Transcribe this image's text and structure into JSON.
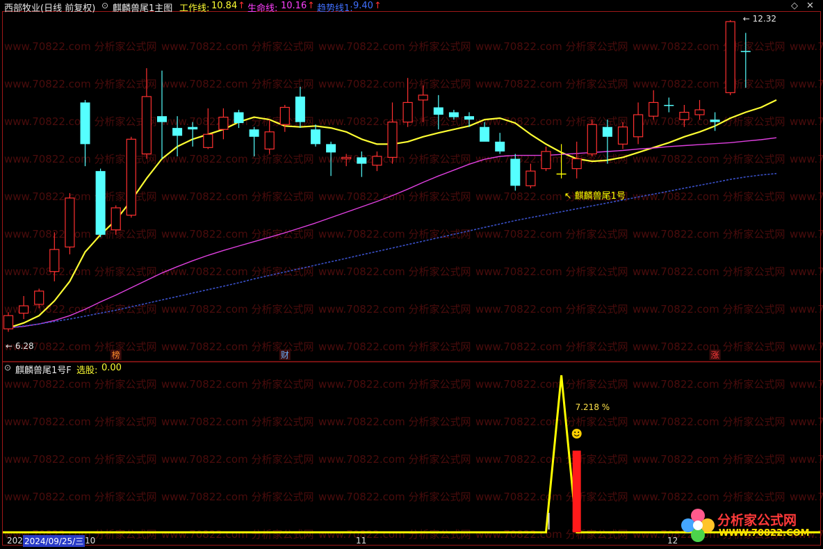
{
  "header": {
    "stock_title": "西部牧业(日线 前复权)",
    "main_indicator": "麒麟兽尾1主图",
    "work_line_label": "工作线:",
    "work_line_value": "10.84",
    "life_line_label": "生命线:",
    "life_line_value": "10.16",
    "trend_line_label": "趋势线1:",
    "trend_line_value": "9.40",
    "up_arrow": "↑",
    "sub_indicator": "麒麟兽尾1号F",
    "select_label": "选股:",
    "select_value": "0.00"
  },
  "colors": {
    "up": "#ff3030",
    "down": "#55ffff",
    "signal": "#ffff00",
    "work_line": "#ffff33",
    "life_line": "#e040e0",
    "trend_line": "#3a50c8",
    "frame": "#a01818",
    "watermark": "#4a0c0c"
  },
  "icons": {
    "settings": "diamond-icon",
    "close": "close-icon",
    "smiley": "smiley-icon"
  },
  "watermark_text": "www.70822.com 分析家公式网",
  "logo": {
    "cn": "分析家公式网",
    "url": "WWW.70822.COM"
  },
  "chart_data": [
    {
      "type": "candlestick",
      "title": "麒麟兽尾1主图",
      "ylim": [
        5.9,
        12.75
      ],
      "price_high_label": "12.32",
      "price_low_label": "6.28",
      "signal_label": "麒麟兽尾1号",
      "signal_index": 36,
      "event_markers": [
        {
          "index": 7,
          "text": "榜",
          "color": "#ff8c2c"
        },
        {
          "index": 18,
          "text": "财",
          "color": "#6ab0ff"
        },
        {
          "index": 46,
          "text": "涨",
          "color": "#ff3b3b"
        }
      ],
      "candles": [
        {
          "o": 6.28,
          "c": 6.55,
          "h": 6.62,
          "l": 6.22
        },
        {
          "o": 6.6,
          "c": 6.75,
          "h": 6.95,
          "l": 6.48
        },
        {
          "o": 6.78,
          "c": 7.05,
          "h": 7.1,
          "l": 6.7
        },
        {
          "o": 7.45,
          "c": 7.9,
          "h": 8.25,
          "l": 7.25
        },
        {
          "o": 7.95,
          "c": 8.95,
          "h": 9.05,
          "l": 7.8
        },
        {
          "o": 10.9,
          "c": 10.05,
          "h": 10.95,
          "l": 9.6
        },
        {
          "o": 9.5,
          "c": 8.2,
          "h": 9.55,
          "l": 8.15
        },
        {
          "o": 8.3,
          "c": 8.75,
          "h": 8.8,
          "l": 8.2
        },
        {
          "o": 8.6,
          "c": 10.15,
          "h": 10.2,
          "l": 8.55
        },
        {
          "o": 9.85,
          "c": 11.02,
          "h": 11.6,
          "l": 9.75
        },
        {
          "o": 10.62,
          "c": 10.5,
          "h": 11.55,
          "l": 9.75
        },
        {
          "o": 10.38,
          "c": 10.22,
          "h": 10.62,
          "l": 9.8
        },
        {
          "o": 10.4,
          "c": 10.35,
          "h": 10.5,
          "l": 10.0
        },
        {
          "o": 9.98,
          "c": 10.25,
          "h": 10.78,
          "l": 9.95
        },
        {
          "o": 10.35,
          "c": 10.6,
          "h": 10.78,
          "l": 10.15
        },
        {
          "o": 10.7,
          "c": 10.48,
          "h": 10.75,
          "l": 10.38
        },
        {
          "o": 10.35,
          "c": 10.2,
          "h": 10.4,
          "l": 9.8
        },
        {
          "o": 9.95,
          "c": 10.3,
          "h": 10.55,
          "l": 9.85
        },
        {
          "o": 10.45,
          "c": 10.8,
          "h": 10.85,
          "l": 10.3
        },
        {
          "o": 11.02,
          "c": 10.5,
          "h": 11.22,
          "l": 10.38
        },
        {
          "o": 10.35,
          "c": 10.05,
          "h": 10.45,
          "l": 10.0
        },
        {
          "o": 10.05,
          "c": 9.88,
          "h": 10.1,
          "l": 9.4
        },
        {
          "o": 9.75,
          "c": 9.78,
          "h": 9.85,
          "l": 9.6
        },
        {
          "o": 9.78,
          "c": 9.65,
          "h": 9.9,
          "l": 9.38
        },
        {
          "o": 9.62,
          "c": 9.8,
          "h": 9.9,
          "l": 9.5
        },
        {
          "o": 9.78,
          "c": 10.5,
          "h": 10.9,
          "l": 9.65
        },
        {
          "o": 10.5,
          "c": 10.9,
          "h": 11.4,
          "l": 10.4
        },
        {
          "o": 10.95,
          "c": 11.05,
          "h": 11.25,
          "l": 10.5
        },
        {
          "o": 10.8,
          "c": 10.65,
          "h": 11.05,
          "l": 10.35
        },
        {
          "o": 10.7,
          "c": 10.6,
          "h": 10.75,
          "l": 10.55
        },
        {
          "o": 10.62,
          "c": 10.55,
          "h": 10.7,
          "l": 10.4
        },
        {
          "o": 10.4,
          "c": 10.1,
          "h": 10.5,
          "l": 10.15
        },
        {
          "o": 10.1,
          "c": 9.9,
          "h": 10.28,
          "l": 9.85
        },
        {
          "o": 9.75,
          "c": 9.2,
          "h": 9.85,
          "l": 9.1
        },
        {
          "o": 9.2,
          "c": 9.5,
          "h": 9.65,
          "l": 9.15
        },
        {
          "o": 9.55,
          "c": 9.9,
          "h": 10.0,
          "l": 9.5
        },
        {
          "o": 9.45,
          "c": 9.43,
          "h": 10.05,
          "l": 9.35
        },
        {
          "o": 9.55,
          "c": 9.75,
          "h": 10.1,
          "l": 9.35
        },
        {
          "o": 9.85,
          "c": 10.45,
          "h": 10.55,
          "l": 9.8
        },
        {
          "o": 10.4,
          "c": 10.2,
          "h": 10.55,
          "l": 9.65
        },
        {
          "o": 10.05,
          "c": 10.4,
          "h": 10.5,
          "l": 9.95
        },
        {
          "o": 10.2,
          "c": 10.65,
          "h": 10.9,
          "l": 10.05
        },
        {
          "o": 10.62,
          "c": 10.9,
          "h": 11.15,
          "l": 10.55
        },
        {
          "o": 10.85,
          "c": 10.85,
          "h": 11.0,
          "l": 10.7
        },
        {
          "o": 10.55,
          "c": 10.7,
          "h": 10.85,
          "l": 10.4
        },
        {
          "o": 10.65,
          "c": 10.75,
          "h": 10.95,
          "l": 10.55
        },
        {
          "o": 10.55,
          "c": 10.5,
          "h": 10.7,
          "l": 10.32
        },
        {
          "o": 11.1,
          "c": 12.55,
          "h": 12.58,
          "l": 11.05
        },
        {
          "o": 11.95,
          "c": 11.95,
          "h": 12.32,
          "l": 11.2
        }
      ],
      "series": [
        {
          "name": "工作线",
          "values": [
            6.3,
            6.4,
            6.55,
            6.85,
            7.25,
            7.85,
            8.2,
            8.5,
            8.9,
            9.35,
            9.75,
            10.0,
            10.15,
            10.25,
            10.35,
            10.5,
            10.6,
            10.55,
            10.42,
            10.4,
            10.42,
            10.38,
            10.3,
            10.15,
            10.05,
            10.05,
            10.1,
            10.2,
            10.28,
            10.35,
            10.42,
            10.55,
            10.58,
            10.48,
            10.25,
            10.05,
            9.88,
            9.75,
            9.7,
            9.72,
            9.78,
            9.88,
            9.98,
            10.08,
            10.2,
            10.3,
            10.42,
            10.58,
            10.7,
            10.8,
            10.95
          ]
        },
        {
          "name": "生命线",
          "values": [
            6.3,
            6.33,
            6.38,
            6.45,
            6.55,
            6.68,
            6.83,
            6.97,
            7.12,
            7.27,
            7.42,
            7.55,
            7.67,
            7.78,
            7.88,
            7.97,
            8.06,
            8.15,
            8.24,
            8.34,
            8.44,
            8.55,
            8.66,
            8.77,
            8.88,
            9.0,
            9.13,
            9.27,
            9.4,
            9.52,
            9.64,
            9.74,
            9.8,
            9.82,
            9.82,
            9.82,
            9.84,
            9.86,
            9.88,
            9.9,
            9.92,
            9.95,
            9.97,
            10.0,
            10.02,
            10.04,
            10.06,
            10.08,
            10.11,
            10.14,
            10.18
          ]
        },
        {
          "name": "趋势线1",
          "values": [
            6.3,
            6.34,
            6.38,
            6.43,
            6.48,
            6.54,
            6.6,
            6.66,
            6.73,
            6.8,
            6.87,
            6.94,
            7.01,
            7.08,
            7.15,
            7.22,
            7.3,
            7.37,
            7.44,
            7.51,
            7.58,
            7.65,
            7.72,
            7.79,
            7.86,
            7.93,
            8.0,
            8.07,
            8.14,
            8.21,
            8.28,
            8.35,
            8.42,
            8.49,
            8.55,
            8.61,
            8.67,
            8.73,
            8.79,
            8.85,
            8.91,
            8.97,
            9.03,
            9.09,
            9.15,
            9.21,
            9.27,
            9.33,
            9.38,
            9.42,
            9.45
          ]
        }
      ]
    },
    {
      "type": "line",
      "title": "麒麟兽尾1号F",
      "ylim": [
        0,
        100
      ],
      "peak_index": 36,
      "series": [
        {
          "name": "选股",
          "values": [
            0,
            0,
            0,
            0,
            0,
            0,
            0,
            0,
            0,
            0,
            0,
            0,
            0,
            0,
            0,
            0,
            0,
            0,
            0,
            0,
            0,
            0,
            0,
            0,
            0,
            0,
            0,
            0,
            0,
            0,
            0,
            0,
            0,
            0,
            0,
            0,
            100,
            0,
            0,
            0,
            0,
            0,
            0,
            0,
            0,
            0,
            0,
            0,
            0,
            0,
            0
          ]
        }
      ],
      "bar": {
        "index": 37,
        "value": 52
      },
      "annotation": "7.218 %"
    }
  ],
  "axis": {
    "date_cursor": "2024/09/25/三",
    "left_fragment": "202",
    "left_fragment2": "10",
    "month_11": "11",
    "month_12": "12"
  }
}
